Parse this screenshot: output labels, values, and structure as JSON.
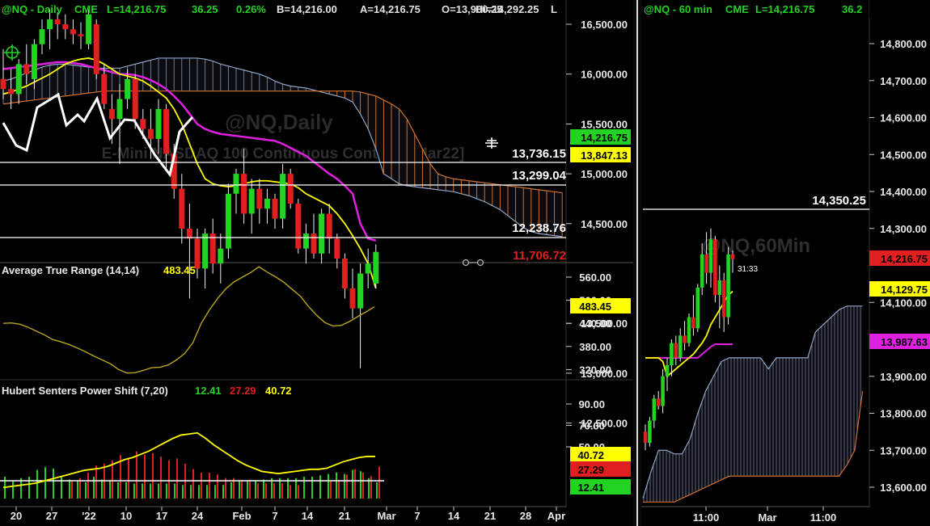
{
  "colors": {
    "up": "#22d322",
    "down": "#e02020",
    "magenta": "#e020e0",
    "yellow": "#ffff00",
    "orange": "#d07030",
    "steel": "#8fa6c8",
    "white": "#ffffff"
  },
  "left_header": {
    "symbol": "@NQ - Daily",
    "exchange": "CME",
    "last": "L=14,216.75",
    "change": "36.25",
    "pct": "0.26%",
    "bid": "B=14,216.00",
    "ask": "A=14,216.75",
    "open": "O=13,900.25",
    "high": "Hi=14,292.25",
    "trail": "L"
  },
  "right_header": {
    "symbol": "@NQ - 60 min",
    "exchange": "CME",
    "last": "L=14,216.75",
    "change": "36.2"
  },
  "left_watermark": {
    "line1": "@NQ,Daily",
    "line2": "E-Mini NASDAQ 100 Continuous Contract [Mar22]"
  },
  "right_watermark": "@NQ,60Min",
  "left_price_labels": [
    {
      "text": "13,736.15",
      "color": "#ffffff"
    },
    {
      "text": "13,299.04",
      "color": "#ffffff"
    },
    {
      "text": "12,238.76",
      "color": "#ffffff"
    },
    {
      "text": "11,706.72",
      "color": "#e02020"
    }
  ],
  "right_price_label": "14,350.25",
  "right_timer": "31:33",
  "left_axis_ticks": [
    "16,500.00",
    "16,000.00",
    "15,500.00",
    "15,000.00",
    "14,500.00",
    "13,500.00",
    "13,000.00",
    "12,500.00"
  ],
  "left_markers": [
    {
      "text": "14,216.75",
      "bg": "#22d322",
      "fg": "#000000"
    },
    {
      "text": "13,847.13",
      "bg": "#ffff00",
      "fg": "#000000"
    }
  ],
  "atr": {
    "title": "Average True Range (14,14)",
    "value": "483.45",
    "ticks": [
      "560.00",
      "500.00",
      "440.00",
      "380.00",
      "320.00"
    ],
    "marker": "483.45"
  },
  "hubert": {
    "title": "Hubert Senters Power Shift (7,20)",
    "v1": "12.41",
    "v2": "27.29",
    "v3": "40.72",
    "ticks": [
      "90.00",
      "70.00",
      "50.00"
    ],
    "markers": [
      {
        "text": "40.72",
        "bg": "#ffff00",
        "fg": "#000000"
      },
      {
        "text": "27.29",
        "bg": "#e02020",
        "fg": "#000000"
      },
      {
        "text": "12.41",
        "bg": "#22d322",
        "fg": "#000000"
      }
    ]
  },
  "left_xaxis": [
    "20",
    "27",
    "'22",
    "10",
    "17",
    "24",
    "Feb",
    "7",
    "14",
    "21",
    "Mar",
    "7",
    "14",
    "21",
    "28",
    "Apr"
  ],
  "right_axis_ticks": [
    "14,800.00",
    "14,700.00",
    "14,600.00",
    "14,500.00",
    "14,400.00",
    "14,300.00",
    "14,100.00",
    "13,900.00",
    "13,800.00",
    "13,700.00",
    "13,600.00"
  ],
  "right_markers": [
    {
      "text": "14,216.75",
      "bg": "#e02020",
      "fg": "#000000"
    },
    {
      "text": "14,129.75",
      "bg": "#ffff00",
      "fg": "#000000"
    },
    {
      "text": "13,987.63",
      "bg": "#e020e0",
      "fg": "#000000"
    }
  ],
  "right_xaxis": [
    "11:00",
    "Mar",
    "11:00"
  ],
  "chart_data": [
    {
      "type": "candlestick",
      "title": "@NQ - Daily",
      "ylim": [
        12250,
        16750
      ],
      "candles": [
        {
          "o": 15950,
          "h": 16250,
          "l": 15750,
          "c": 15850
        },
        {
          "o": 15850,
          "h": 16050,
          "l": 15650,
          "c": 15800
        },
        {
          "o": 15800,
          "h": 16150,
          "l": 15700,
          "c": 16100
        },
        {
          "o": 16100,
          "h": 16300,
          "l": 15900,
          "c": 16000
        },
        {
          "o": 15950,
          "h": 16350,
          "l": 15850,
          "c": 16300
        },
        {
          "o": 16300,
          "h": 16550,
          "l": 16200,
          "c": 16450
        },
        {
          "o": 16450,
          "h": 16650,
          "l": 16250,
          "c": 16550
        },
        {
          "o": 16550,
          "h": 16620,
          "l": 16350,
          "c": 16500
        },
        {
          "o": 16500,
          "h": 16600,
          "l": 16350,
          "c": 16450
        },
        {
          "o": 16450,
          "h": 16550,
          "l": 16300,
          "c": 16400
        },
        {
          "o": 16400,
          "h": 16520,
          "l": 16250,
          "c": 16380
        },
        {
          "o": 16300,
          "h": 16650,
          "l": 16250,
          "c": 16600
        },
        {
          "o": 16500,
          "h": 16550,
          "l": 15950,
          "c": 16000
        },
        {
          "o": 16000,
          "h": 16100,
          "l": 15650,
          "c": 15700
        },
        {
          "o": 15650,
          "h": 15800,
          "l": 15300,
          "c": 15550
        },
        {
          "o": 15550,
          "h": 15900,
          "l": 15100,
          "c": 15750
        },
        {
          "o": 15750,
          "h": 16050,
          "l": 15650,
          "c": 15950
        },
        {
          "o": 15950,
          "h": 16000,
          "l": 15450,
          "c": 15550
        },
        {
          "o": 15550,
          "h": 15650,
          "l": 15350,
          "c": 15450
        },
        {
          "o": 15450,
          "h": 15650,
          "l": 15150,
          "c": 15350
        },
        {
          "o": 15350,
          "h": 15750,
          "l": 15200,
          "c": 15650
        },
        {
          "o": 15650,
          "h": 15700,
          "l": 15050,
          "c": 15200
        },
        {
          "o": 15200,
          "h": 15300,
          "l": 14750,
          "c": 14850
        },
        {
          "o": 14850,
          "h": 15000,
          "l": 14300,
          "c": 14450
        },
        {
          "o": 14450,
          "h": 14700,
          "l": 13750,
          "c": 14350
        },
        {
          "o": 14350,
          "h": 14450,
          "l": 13950,
          "c": 14050
        },
        {
          "o": 14050,
          "h": 14450,
          "l": 13850,
          "c": 14400
        },
        {
          "o": 14400,
          "h": 14550,
          "l": 14000,
          "c": 14100
        },
        {
          "o": 14100,
          "h": 14400,
          "l": 13900,
          "c": 14250
        },
        {
          "o": 14250,
          "h": 14900,
          "l": 14150,
          "c": 14800
        },
        {
          "o": 14800,
          "h": 15050,
          "l": 14600,
          "c": 15000
        },
        {
          "o": 15000,
          "h": 15250,
          "l": 14500,
          "c": 14600
        },
        {
          "o": 14600,
          "h": 14950,
          "l": 14400,
          "c": 14850
        },
        {
          "o": 14850,
          "h": 14950,
          "l": 14500,
          "c": 14650
        },
        {
          "o": 14650,
          "h": 14850,
          "l": 14500,
          "c": 14750
        },
        {
          "o": 14750,
          "h": 14800,
          "l": 14450,
          "c": 14550
        },
        {
          "o": 14550,
          "h": 15100,
          "l": 14450,
          "c": 15000
        },
        {
          "o": 15000,
          "h": 15050,
          "l": 14650,
          "c": 14700
        },
        {
          "o": 14700,
          "h": 14750,
          "l": 14200,
          "c": 14250
        },
        {
          "o": 14250,
          "h": 14500,
          "l": 14100,
          "c": 14400
        },
        {
          "o": 14400,
          "h": 14600,
          "l": 14150,
          "c": 14200
        },
        {
          "o": 14200,
          "h": 14650,
          "l": 14100,
          "c": 14600
        },
        {
          "o": 14600,
          "h": 14700,
          "l": 14200,
          "c": 14350
        },
        {
          "o": 14350,
          "h": 14400,
          "l": 14050,
          "c": 14150
        },
        {
          "o": 14150,
          "h": 14200,
          "l": 13750,
          "c": 13850
        },
        {
          "o": 13850,
          "h": 14050,
          "l": 13550,
          "c": 13650
        },
        {
          "o": 13650,
          "h": 14100,
          "l": 13050,
          "c": 14000
        },
        {
          "o": 14000,
          "h": 14250,
          "l": 13850,
          "c": 14100
        },
        {
          "o": 13900,
          "h": 14292,
          "l": 13850,
          "c": 14217
        }
      ],
      "ma_magenta": [
        16050,
        16060,
        16070,
        16080,
        16090,
        16100,
        16110,
        16120,
        16120,
        16110,
        16100,
        16080,
        16060,
        16040,
        16020,
        16000,
        16000,
        15990,
        15970,
        15940,
        15900,
        15850,
        15780,
        15700,
        15600,
        15500,
        15450,
        15420,
        15400,
        15390,
        15380,
        15370,
        15360,
        15350,
        15340,
        15330,
        15300,
        15260,
        15220,
        15180,
        15120,
        15060,
        15000,
        14950,
        14880,
        14800,
        14500,
        14350,
        14330
      ],
      "ma_yellow": [
        15800,
        15820,
        15850,
        15880,
        15920,
        15960,
        16000,
        16050,
        16100,
        16130,
        16150,
        16160,
        16140,
        16100,
        16050,
        16000,
        15980,
        15960,
        15930,
        15880,
        15820,
        15760,
        15650,
        15500,
        15300,
        15100,
        14950,
        14900,
        14880,
        14870,
        14880,
        14900,
        14920,
        14930,
        14930,
        14920,
        14910,
        14900,
        14860,
        14800,
        14760,
        14720,
        14680,
        14600,
        14500,
        14380,
        14250,
        14100,
        13850
      ],
      "cloud_upper": [
        15930,
        15950,
        15980,
        16010,
        16040,
        16070,
        16090,
        16100,
        16100,
        16090,
        16080,
        16070,
        16060,
        16060,
        16060,
        16060,
        16080,
        16100,
        16120,
        16140,
        16160,
        16160,
        16160,
        16160,
        16160,
        16160,
        16150,
        16130,
        16100,
        16080,
        16060,
        16040,
        16020,
        16000,
        15970,
        15930,
        15900,
        15880,
        15870,
        15860,
        15840,
        15820,
        15800,
        15780,
        15760,
        15720,
        15600,
        15450,
        15250,
        15000,
        14950,
        14900,
        14880,
        14870,
        14860,
        14850,
        14840,
        14830,
        14820,
        14800,
        14780,
        14750,
        14720,
        14680,
        14640,
        14580,
        14520,
        14460,
        14420,
        14400,
        14390,
        14380,
        14370
      ],
      "cloud_lower": [
        15700,
        15710,
        15720,
        15730,
        15740,
        15750,
        15760,
        15770,
        15780,
        15790,
        15800,
        15810,
        15820,
        15830,
        15830,
        15830,
        15830,
        15830,
        15830,
        15830,
        15830,
        15830,
        15830,
        15830,
        15830,
        15830,
        15830,
        15830,
        15830,
        15830,
        15830,
        15830,
        15830,
        15830,
        15830,
        15830,
        15830,
        15830,
        15830,
        15830,
        15830,
        15830,
        15830,
        15830,
        15830,
        15830,
        15820,
        15800,
        15780,
        15740,
        15700,
        15650,
        15550,
        15400,
        15250,
        15100,
        15000,
        14970,
        14950,
        14940,
        14930,
        14920,
        14910,
        14900,
        14890,
        14880,
        14870,
        14860,
        14850,
        14840,
        14830,
        14820,
        14810
      ],
      "levels": [
        13736.15,
        13299.04,
        12238.76
      ]
    },
    {
      "type": "line",
      "title": "Average True Range (14,14)",
      "ylim": [
        260,
        620
      ],
      "values": [
        440,
        441,
        438,
        430,
        420,
        410,
        398,
        392,
        385,
        376,
        366,
        355,
        345,
        335,
        320,
        311,
        312,
        318,
        325,
        326,
        332,
        345,
        362,
        390,
        440,
        475,
        505,
        530,
        548,
        560,
        572,
        587,
        573,
        561,
        547,
        529,
        511,
        484,
        461,
        442,
        433,
        435,
        445,
        458,
        470,
        483
      ]
    },
    {
      "type": "bar",
      "title": "Hubert Senters Power Shift (7,20)",
      "ylim": [
        0,
        110
      ],
      "line_values": [
        12,
        13,
        14,
        15,
        16,
        18,
        20,
        22,
        24,
        26,
        28,
        29,
        30,
        32,
        35,
        38,
        40,
        43,
        46,
        50,
        54,
        58,
        61,
        62,
        63,
        58,
        52,
        47,
        42,
        37,
        33,
        30,
        27,
        26,
        25,
        26,
        27,
        28,
        29,
        29,
        30,
        33,
        36,
        38,
        40,
        41,
        41
      ],
      "green_bars": [
        20,
        14,
        18,
        20,
        30,
        34,
        32,
        20,
        16,
        14,
        12,
        20,
        16,
        14,
        12,
        12,
        10,
        10,
        10,
        10,
        10,
        10,
        8,
        8,
        8,
        8,
        8,
        8,
        12,
        14,
        14,
        14,
        16,
        18,
        18,
        18,
        18,
        20,
        20,
        22,
        24,
        26,
        24,
        30,
        28,
        18,
        12
      ],
      "red_bars": [
        0,
        0,
        0,
        0,
        0,
        0,
        0,
        0,
        10,
        14,
        20,
        28,
        30,
        34,
        40,
        36,
        44,
        40,
        42,
        38,
        34,
        36,
        30,
        24,
        20,
        20,
        18,
        14,
        14,
        12,
        12,
        8,
        8,
        8,
        8,
        6,
        6,
        0,
        0,
        0,
        10,
        12,
        18,
        24,
        20,
        16,
        27
      ]
    },
    {
      "type": "candlestick",
      "title": "@NQ - 60 min",
      "ylim": [
        13540,
        14870
      ],
      "candles": [
        {
          "o": 13750,
          "h": 13770,
          "l": 13700,
          "c": 13720
        },
        {
          "o": 13720,
          "h": 13790,
          "l": 13710,
          "c": 13780
        },
        {
          "o": 13780,
          "h": 13850,
          "l": 13760,
          "c": 13840
        },
        {
          "o": 13840,
          "h": 13860,
          "l": 13810,
          "c": 13820
        },
        {
          "o": 13820,
          "h": 13920,
          "l": 13800,
          "c": 13900
        },
        {
          "o": 13900,
          "h": 13950,
          "l": 13860,
          "c": 13930
        },
        {
          "o": 13930,
          "h": 14000,
          "l": 13900,
          "c": 13990
        },
        {
          "o": 13990,
          "h": 14010,
          "l": 13930,
          "c": 13950
        },
        {
          "o": 13950,
          "h": 14030,
          "l": 13940,
          "c": 14010
        },
        {
          "o": 14010,
          "h": 14050,
          "l": 13970,
          "c": 13990
        },
        {
          "o": 13990,
          "h": 14070,
          "l": 13980,
          "c": 14060
        },
        {
          "o": 14060,
          "h": 14120,
          "l": 14010,
          "c": 14030
        },
        {
          "o": 14030,
          "h": 14150,
          "l": 14020,
          "c": 14140
        },
        {
          "o": 14140,
          "h": 14260,
          "l": 14120,
          "c": 14230
        },
        {
          "o": 14230,
          "h": 14290,
          "l": 14150,
          "c": 14180
        },
        {
          "o": 14180,
          "h": 14300,
          "l": 14140,
          "c": 14270
        },
        {
          "o": 14270,
          "h": 14280,
          "l": 14100,
          "c": 14120
        },
        {
          "o": 14120,
          "h": 14200,
          "l": 14030,
          "c": 14160
        },
        {
          "o": 14160,
          "h": 14180,
          "l": 14020,
          "c": 14060
        },
        {
          "o": 14060,
          "h": 14250,
          "l": 14040,
          "c": 14230
        },
        {
          "o": 14230,
          "h": 14240,
          "l": 14180,
          "c": 14217
        }
      ],
      "ma_magenta": [
        13950,
        13950,
        13950,
        13950,
        13950,
        13950,
        13950,
        13950,
        13950,
        13950,
        13950,
        13950,
        13950,
        13960,
        13970,
        13980,
        13987,
        13987,
        13987,
        13987,
        13987
      ],
      "ma_yellow": [
        13950,
        13950,
        13950,
        13950,
        13940,
        13900,
        13910,
        13920,
        13930,
        13940,
        13950,
        13960,
        13975,
        13990,
        14010,
        14040,
        14060,
        14080,
        14100,
        14120,
        14130
      ],
      "cloud_upper": [
        13570,
        13640,
        13700,
        13700,
        13690,
        13690,
        13730,
        13800,
        13860,
        13900,
        13940,
        13950,
        13950,
        13950,
        13950,
        13950,
        13920,
        13950,
        13950,
        13950,
        13950,
        13950,
        14020,
        14040,
        14060,
        14080,
        14090,
        14090,
        14090
      ],
      "cloud_lower": [
        13560,
        13560,
        13560,
        13560,
        13560,
        13570,
        13580,
        13590,
        13600,
        13610,
        13620,
        13630,
        13630,
        13630,
        13630,
        13630,
        13630,
        13630,
        13630,
        13630,
        13630,
        13630,
        13630,
        13630,
        13630,
        13630,
        13660,
        13700,
        13860
      ],
      "levels": [
        14350.25
      ]
    }
  ]
}
